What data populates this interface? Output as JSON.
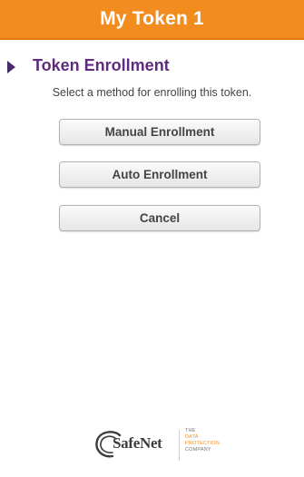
{
  "header": {
    "title": "My Token 1"
  },
  "section": {
    "title": "Token Enrollment",
    "instruction": "Select a method for enrolling this token."
  },
  "buttons": {
    "manual": "Manual Enrollment",
    "auto": "Auto Enrollment",
    "cancel": "Cancel"
  },
  "footer": {
    "logo_text": "SafeNet",
    "tagline": [
      "THE",
      "DATA",
      "PROTECTION",
      "COMPANY"
    ]
  },
  "colors": {
    "header_bg": "#f28c1e",
    "section_title": "#5e2b7e",
    "marker": "#4b2a6b"
  }
}
